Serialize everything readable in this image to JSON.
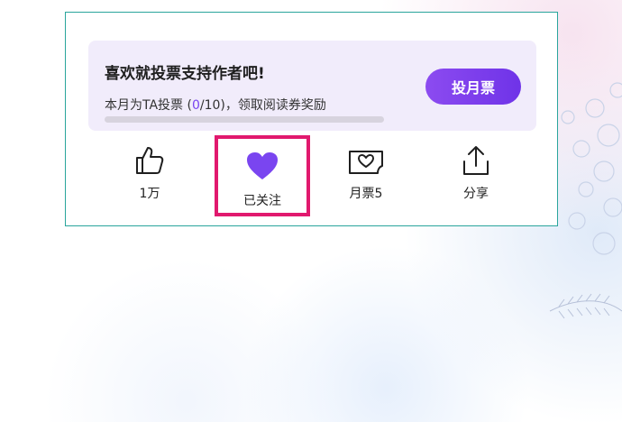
{
  "panel": {
    "title": "喜欢就投票支持作者吧!",
    "subtitle_prefix": "本月为TA投票 (",
    "votes_current": "0",
    "subtitle_suffix": "/10)，领取阅读券奖励",
    "progress_fraction": 0,
    "vote_button_label": "投月票"
  },
  "actions": [
    {
      "label": "1万",
      "icon": "thumbs-up-icon"
    },
    {
      "label": "已关注",
      "icon": "heart-icon"
    },
    {
      "label": "月票5",
      "icon": "monthly-ticket-icon"
    },
    {
      "label": "分享",
      "icon": "share-icon"
    }
  ],
  "colors": {
    "accent": "#7a45f0",
    "highlight_border": "#e1196e",
    "panel_bg": "#f1ecfb",
    "card_border": "#2aa59c"
  }
}
